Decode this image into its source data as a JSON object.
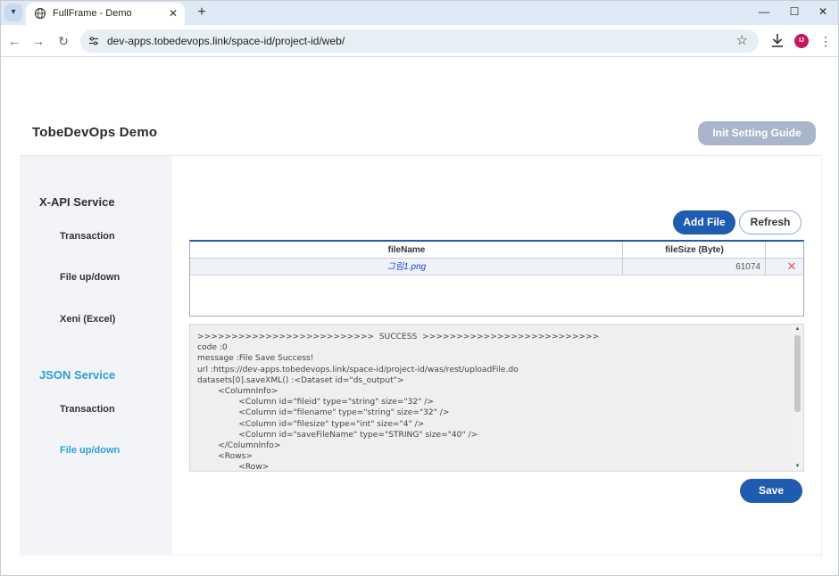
{
  "browser": {
    "tab_title": "FullFrame - Demo",
    "url": "dev-apps.tobedevops.link/space-id/project-id/web/",
    "avatar_initials": "IJ",
    "icons": [
      "tab-menu-icon",
      "globe-icon",
      "close-icon",
      "plus-icon",
      "minimize-icon",
      "maximize-icon",
      "window-close-icon",
      "back-icon",
      "forward-icon",
      "reload-icon",
      "tune-icon",
      "star-icon",
      "download-icon",
      "kebab-menu-icon"
    ]
  },
  "header": {
    "title": "TobeDevOps Demo",
    "guide_button": "Init Setting Guide"
  },
  "sidebar": {
    "sections": [
      {
        "title": "X-API Service",
        "active": false,
        "items": [
          "Transaction",
          "File up/down",
          "Xeni (Excel)"
        ]
      },
      {
        "title": "JSON Service",
        "active": true,
        "items": [
          "Transaction",
          "File up/down"
        ]
      }
    ],
    "active_item": "File up/down"
  },
  "toolbar": {
    "add_label": "Add File",
    "refresh_label": "Refresh"
  },
  "grid": {
    "columns": [
      "fileName",
      "fileSize (Byte)",
      ""
    ],
    "rows": [
      {
        "fileName": "그림1.png",
        "fileSize": "61074"
      }
    ]
  },
  "log": {
    "lines": [
      ">>>>>>>>>>>>>>>>>>>>>>>>>>  SUCCESS  >>>>>>>>>>>>>>>>>>>>>>>>>>",
      "code :0",
      "message :File Save Success!",
      "url :https://dev-apps.tobedevops.link/space-id/project-id/was/rest/uploadFile.do",
      "datasets[0].saveXML() :<Dataset id=\"ds_output\">",
      "        <ColumnInfo>",
      "                <Column id=\"fileid\" type=\"string\" size=\"32\" />",
      "                <Column id=\"filename\" type=\"string\" size=\"32\" />",
      "                <Column id=\"filesize\" type=\"int\" size=\"4\" />",
      "                <Column id=\"saveFileName\" type=\"STRING\" size=\"40\" />",
      "        </ColumnInfo>",
      "        <Rows>",
      "                <Row>"
    ]
  },
  "actions": {
    "save_label": "Save"
  },
  "colors": {
    "primary": "#1f5cb0",
    "active_text": "#2aa0d8",
    "guide_button": "#a9b5cc",
    "delete_icon": "#e25757"
  }
}
